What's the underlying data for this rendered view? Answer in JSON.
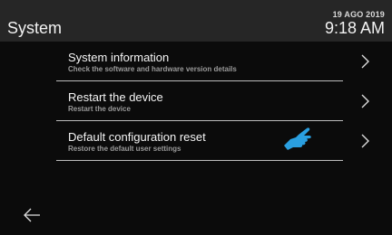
{
  "header": {
    "title": "System",
    "date": "19 AGO 2019",
    "time": "9:18 AM"
  },
  "menu": {
    "items": [
      {
        "title": "System information",
        "subtitle": "Check the software and hardware version details",
        "icon": "chevron-right-icon"
      },
      {
        "title": "Restart the device",
        "subtitle": "Restart the device",
        "icon": "chevron-right-icon"
      },
      {
        "title": "Default configuration reset",
        "subtitle": "Restore the default user settings",
        "icon": "chevron-right-icon"
      }
    ]
  },
  "pointer": {
    "icon": "hand-pointer-icon",
    "color": "#2a9fe0"
  },
  "footer": {
    "back_icon": "back-arrow-icon"
  },
  "colors": {
    "background": "#0b0b0b",
    "header": "#262626",
    "text": "#f5f5f5",
    "subtext": "#9a9a9a",
    "divider": "#bdbdbd"
  }
}
